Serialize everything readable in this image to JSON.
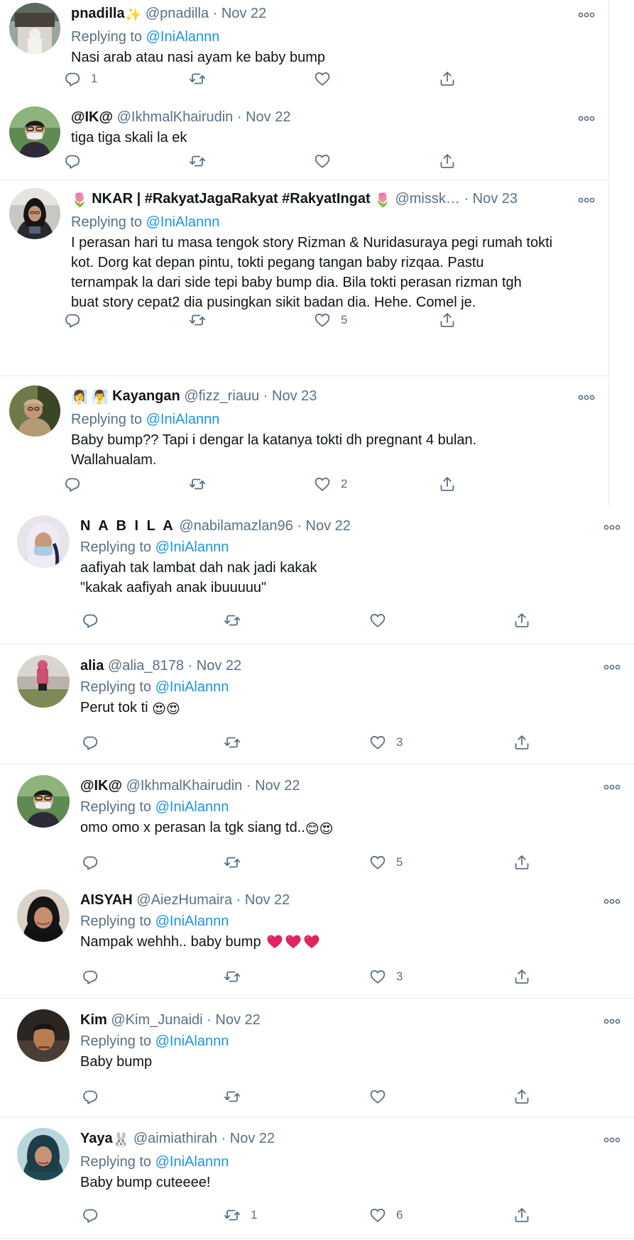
{
  "colors": {
    "link": "#1b95e0",
    "secondary": "#5b7083",
    "text": "#0f1419",
    "heart": "#e0245e"
  },
  "tweets": [
    {
      "name": "pnadilla",
      "name_emoji": "✨",
      "handle": "@pnadilla",
      "date": "Nov 22",
      "replying_label": "Replying to",
      "replying_handle": "@IniAlannn",
      "lines": [
        "Nasi arab atau nasi ayam ke baby bump"
      ],
      "reply_count": "1",
      "retweet_count": "",
      "like_count": ""
    },
    {
      "name": "@IK@",
      "handle": "@IkhmalKhairudin",
      "date": "Nov 22",
      "lines": [
        "tiga tiga skali la ek"
      ],
      "reply_count": "",
      "retweet_count": "",
      "like_count": ""
    },
    {
      "name_prefix_emoji": "🌷",
      "name": "NKAR | #RakyatJagaRakyat #RakyatIngat",
      "name_suffix_emoji": "🌷",
      "handle": "@missk…",
      "date": "Nov 23",
      "replying_label": "Replying to",
      "replying_handle": "@IniAlannn",
      "lines": [
        "I perasan hari tu masa tengok story Rizman & Nuridasuraya pegi rumah tokti",
        "kot. Dorg kat depan pintu, tokti pegang tangan baby rizqaa. Pastu",
        "ternampak la dari side tepi baby bump dia. Bila tokti perasan rizman tgh",
        "buat story cepat2 dia pusingkan sikit badan dia. Hehe. Comel je."
      ],
      "reply_count": "",
      "retweet_count": "",
      "like_count": "5"
    },
    {
      "name_prefix_emoji": "🧖‍♀️ 🧖‍♂️",
      "name": "Kayangan",
      "handle": "@fizz_riauu",
      "date": "Nov 23",
      "replying_label": "Replying to",
      "replying_handle": "@IniAlannn",
      "lines": [
        "Baby bump?? Tapi i dengar la katanya tokti dh pregnant 4 bulan.",
        "Wallahualam."
      ],
      "reply_count": "",
      "retweet_count": "",
      "like_count": "2"
    },
    {
      "name": "N A B I L A",
      "handle": "@nabilamazlan96",
      "date": "Nov 22",
      "replying_label": "Replying to",
      "replying_handle": "@IniAlannn",
      "lines": [
        "aafiyah tak lambat dah nak jadi kakak",
        "\"kakak aafiyah anak ibuuuuu\""
      ],
      "reply_count": "",
      "retweet_count": "",
      "like_count": ""
    },
    {
      "name": "alia",
      "handle": "@alia_8178",
      "date": "Nov 22",
      "replying_label": "Replying to",
      "replying_handle": "@IniAlannn",
      "lines": [
        "Perut tok ti"
      ],
      "emoji_suffix": "😍😍",
      "reply_count": "",
      "retweet_count": "",
      "like_count": "3"
    },
    {
      "name": "@IK@",
      "handle": "@IkhmalKhairudin",
      "date": "Nov 22",
      "replying_label": "Replying to",
      "replying_handle": "@IniAlannn",
      "lines": [
        "omo omo x perasan la tgk siang td.."
      ],
      "emoji_suffix": "😊😍",
      "reply_count": "",
      "retweet_count": "",
      "like_count": "5"
    },
    {
      "name": "AISYAH",
      "handle": "@AiezHumaira",
      "date": "Nov 22",
      "replying_label": "Replying to",
      "replying_handle": "@IniAlannn",
      "lines": [
        "Nampak wehhh.. baby bump"
      ],
      "hearts": 3,
      "reply_count": "",
      "retweet_count": "",
      "like_count": "3"
    },
    {
      "name": "Kim",
      "handle": "@Kim_Junaidi",
      "date": "Nov 22",
      "replying_label": "Replying to",
      "replying_handle": "@IniAlannn",
      "lines": [
        "Baby bump"
      ],
      "reply_count": "",
      "retweet_count": "",
      "like_count": ""
    },
    {
      "name": "Yaya",
      "name_emoji": "🐰",
      "handle": "@aimiathirah",
      "date": "Nov 22",
      "replying_label": "Replying to",
      "replying_handle": "@IniAlannn",
      "lines": [
        "Baby bump cuteeee!"
      ],
      "reply_count": "",
      "retweet_count": "1",
      "like_count": "6"
    }
  ]
}
